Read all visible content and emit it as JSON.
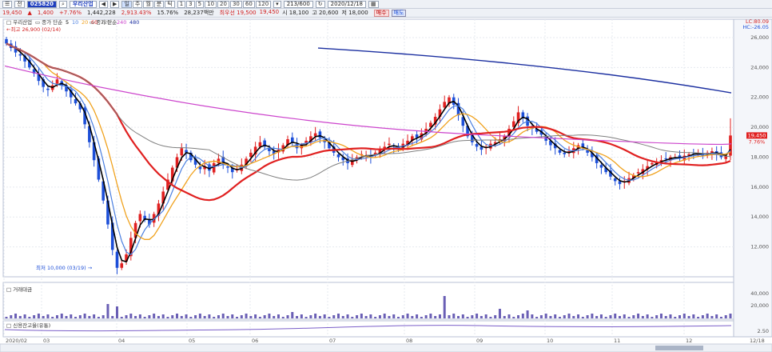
{
  "toolbar1": {
    "code": "025820",
    "name": "우리산업",
    "period_count": "213/600",
    "date": "2020/12/18",
    "period_buttons": [
      "일",
      "주",
      "월",
      "분",
      "틱"
    ],
    "minute_buttons": [
      "1",
      "3",
      "5",
      "10",
      "20",
      "30",
      "60",
      "120"
    ]
  },
  "toolbar2": {
    "price": "19,450",
    "change": "1,400",
    "pct": "+7.76%",
    "volume": "1,442,228",
    "vol_ratio": "2,913.43%",
    "ratio": "15.76%",
    "amount": "28,237백만",
    "quotes": [
      {
        "label": "최우선",
        "value": "19,500"
      },
      {
        "label": "",
        "value": "19,450"
      },
      {
        "label": "시",
        "value": "18,100"
      },
      {
        "label": "고",
        "value": "20,600"
      },
      {
        "label": "저",
        "value": "18,000"
      }
    ],
    "buy_label": "매수",
    "sell_label": "매도"
  },
  "legend": {
    "title": "우리산업",
    "ma_label": "종가 단순",
    "ma_periods": [
      "5",
      "10",
      "20",
      "60",
      "120"
    ],
    "ma_colors": [
      "#000000",
      "#4a7fe0",
      "#f0a21e",
      "#e02020",
      "#7f7f7f"
    ],
    "long_label": "종가 단순",
    "long_periods": [
      "240",
      "480"
    ],
    "long_colors": [
      "#cc44cc",
      "#1b2fa0"
    ],
    "high_note": "최고 26,900 (02/14)",
    "low_note": "최저 10,000 (03/19)"
  },
  "top_right": {
    "lc": "LC:80.09",
    "hc": "HC:-26.05"
  },
  "price_axis": {
    "ticks": [
      "26,000",
      "24,000",
      "22,000",
      "20,000",
      "18,000",
      "16,000",
      "14,000",
      "12,000"
    ],
    "current_price": "19,450",
    "current_pct": "7.76%"
  },
  "chart_data": {
    "type": "candlestick",
    "title": "우리산업",
    "y_range": [
      10000,
      26800
    ],
    "x_labels": [
      "2020/02",
      "03",
      "04",
      "05",
      "06",
      "07",
      "08",
      "09",
      "10",
      "11",
      "12",
      "12/18"
    ],
    "high": {
      "value": 26900,
      "date": "02/14"
    },
    "low": {
      "value": 10000,
      "date": "03/19"
    },
    "closes": [
      25600,
      25300,
      25000,
      24800,
      24400,
      24000,
      23600,
      23100,
      22700,
      22500,
      22800,
      23200,
      22800,
      22400,
      22000,
      21600,
      21200,
      20200,
      19000,
      17800,
      16500,
      15100,
      13500,
      11800,
      10600,
      10900,
      11500,
      12600,
      13600,
      14200,
      13800,
      13500,
      14200,
      14900,
      15700,
      16500,
      17300,
      18000,
      18600,
      18300,
      17800,
      17500,
      17200,
      17400,
      17100,
      17600,
      17900,
      17500,
      17300,
      17000,
      17200,
      17500,
      17900,
      18300,
      18700,
      19000,
      18700,
      18400,
      18200,
      18500,
      18800,
      19200,
      19000,
      18600,
      18800,
      19100,
      19400,
      19600,
      19300,
      19000,
      18600,
      18300,
      18000,
      17800,
      17600,
      17800,
      18000,
      18200,
      18100,
      18000,
      18300,
      18500,
      18700,
      18900,
      18700,
      18500,
      18900,
      19100,
      19400,
      19300,
      19600,
      19900,
      20300,
      20700,
      21200,
      21700,
      22000,
      21500,
      20800,
      20100,
      19400,
      19000,
      18700,
      18500,
      18700,
      18900,
      19000,
      19200,
      19400,
      19900,
      20400,
      21000,
      20600,
      20100,
      19900,
      19700,
      19500,
      19100,
      18800,
      18600,
      18300,
      18200,
      18400,
      18600,
      18800,
      18600,
      18300,
      18000,
      17600,
      17300,
      17000,
      16700,
      16400,
      16200,
      16400,
      16600,
      16800,
      17000,
      17200,
      17400,
      17600,
      17700,
      17800,
      17900,
      18000,
      18000,
      17900,
      18100,
      18200,
      18300,
      18200,
      18100,
      18300,
      18400,
      18200,
      18000,
      18100,
      19450
    ],
    "volume": {
      "axis": [
        "40,000",
        "20,000"
      ],
      "label": "거래대금"
    },
    "credit": {
      "axis": [
        "2.50"
      ],
      "label": "신용잔고율(유통)"
    }
  }
}
